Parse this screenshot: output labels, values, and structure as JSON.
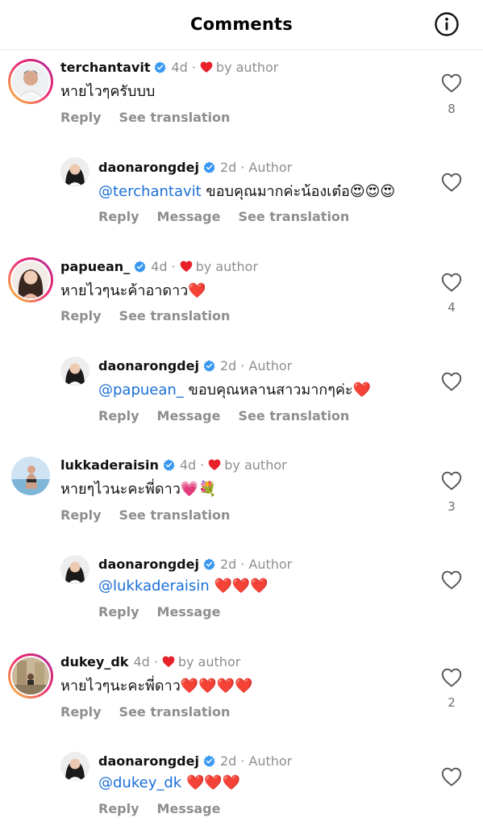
{
  "header": {
    "title": "Comments",
    "info_icon": "info-icon"
  },
  "colors": {
    "mention": "#1a6fd6",
    "heart": "#e8202a",
    "verified": "#3897f0",
    "muted": "#8e8e8e"
  },
  "comments": [
    {
      "username": "terchantavit",
      "time": "4d",
      "by_author": "by author",
      "text": "หายไวๆครับบบ",
      "actions": [
        "Reply",
        "See translation"
      ],
      "like_count": "8",
      "reply": {
        "username": "daonarongdej",
        "time": "2d",
        "author_tag": "Author",
        "mention": "@terchantavit",
        "text": " ขอบคุณมากค่ะน้องเต๋อ",
        "emoji": "😍😍😍",
        "actions": [
          "Reply",
          "Message",
          "See translation"
        ]
      }
    },
    {
      "username": "papuean_",
      "time": "4d",
      "by_author": "by author",
      "text": "หายไวๆนะค้าอาดาว",
      "emoji": "❤️",
      "actions": [
        "Reply",
        "See translation"
      ],
      "like_count": "4",
      "reply": {
        "username": "daonarongdej",
        "time": "2d",
        "author_tag": "Author",
        "mention": "@papuean_",
        "text": " ขอบคุณหลานสาวมากๆค่ะ",
        "emoji": "❤️",
        "actions": [
          "Reply",
          "Message",
          "See translation"
        ]
      }
    },
    {
      "username": "lukkaderaisin",
      "time": "4d",
      "by_author": "by author",
      "text": "หายๆไวนะคะพี่ดาว",
      "emoji": "💗💐",
      "actions": [
        "Reply",
        "See translation"
      ],
      "like_count": "3",
      "reply": {
        "username": "daonarongdej",
        "time": "2d",
        "author_tag": "Author",
        "mention": "@lukkaderaisin",
        "text": " ",
        "emoji": "❤️❤️❤️",
        "actions": [
          "Reply",
          "Message"
        ]
      }
    },
    {
      "username": "dukey_dk",
      "time": "4d",
      "by_author": "by author",
      "text": "หายไวๆนะคะพี่ดาว",
      "emoji": "❤️❤️❤️❤️",
      "actions": [
        "Reply",
        "See translation"
      ],
      "like_count": "2",
      "reply": {
        "username": "daonarongdej",
        "time": "2d",
        "author_tag": "Author",
        "mention": "@dukey_dk",
        "text": " ",
        "emoji": "❤️❤️❤️",
        "actions": [
          "Reply",
          "Message"
        ]
      }
    }
  ]
}
